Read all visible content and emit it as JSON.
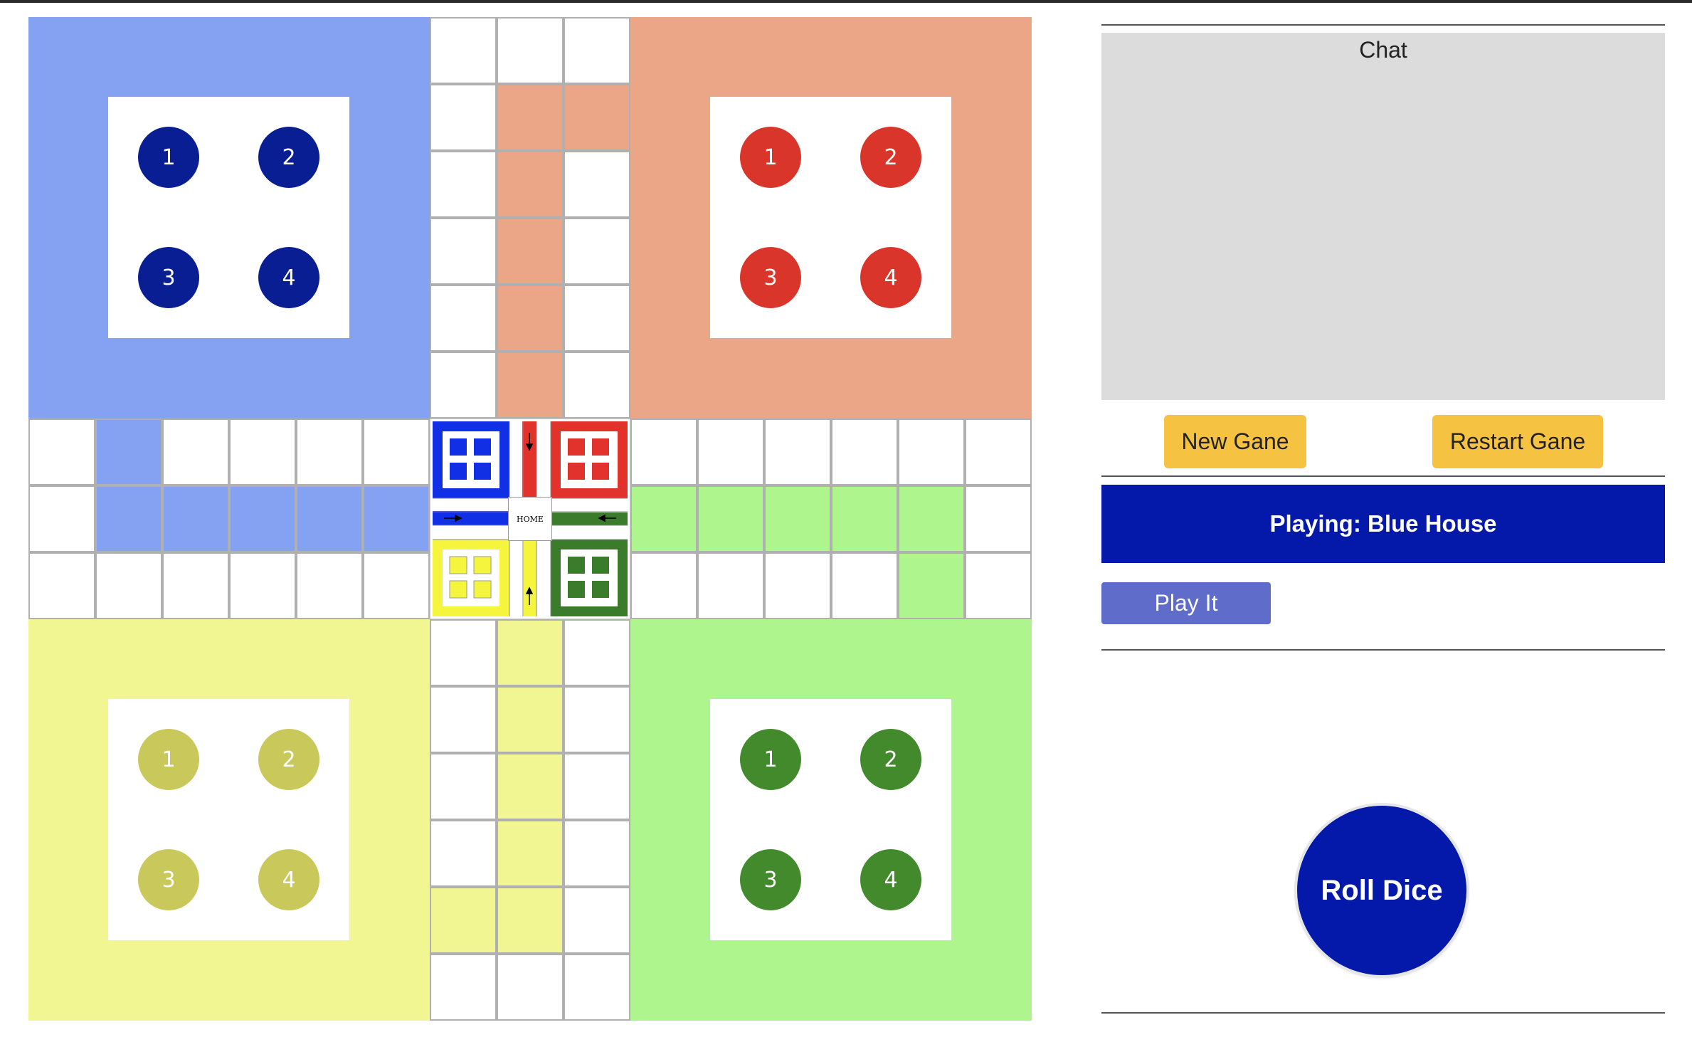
{
  "board": {
    "colors": {
      "blue_house": "#85a1f1",
      "blue_token": "#0a1e94",
      "blue_center": "#1130e6",
      "red_house": "#eba688",
      "red_token": "#d9352a",
      "red_center": "#e2322c",
      "yellow_house": "#f1f692",
      "yellow_token": "#c9c85a",
      "yellow_center": "#f5f53e",
      "green_house": "#aef58d",
      "green_token": "#438a2c",
      "green_center": "#3b7c2c"
    },
    "houses": [
      {
        "name": "blue",
        "tokens": [
          "1",
          "2",
          "3",
          "4"
        ]
      },
      {
        "name": "red",
        "tokens": [
          "1",
          "2",
          "3",
          "4"
        ]
      },
      {
        "name": "yellow",
        "tokens": [
          "1",
          "2",
          "3",
          "4"
        ]
      },
      {
        "name": "green",
        "tokens": [
          "1",
          "2",
          "3",
          "4"
        ]
      }
    ],
    "center_label": "HOME"
  },
  "panel": {
    "chat_title": "Chat",
    "new_game_label": "New Gane",
    "restart_game_label": "Restart Gane",
    "playing_status": "Playing: Blue House",
    "play_it_label": "Play It",
    "roll_dice_label": "Roll Dice"
  }
}
